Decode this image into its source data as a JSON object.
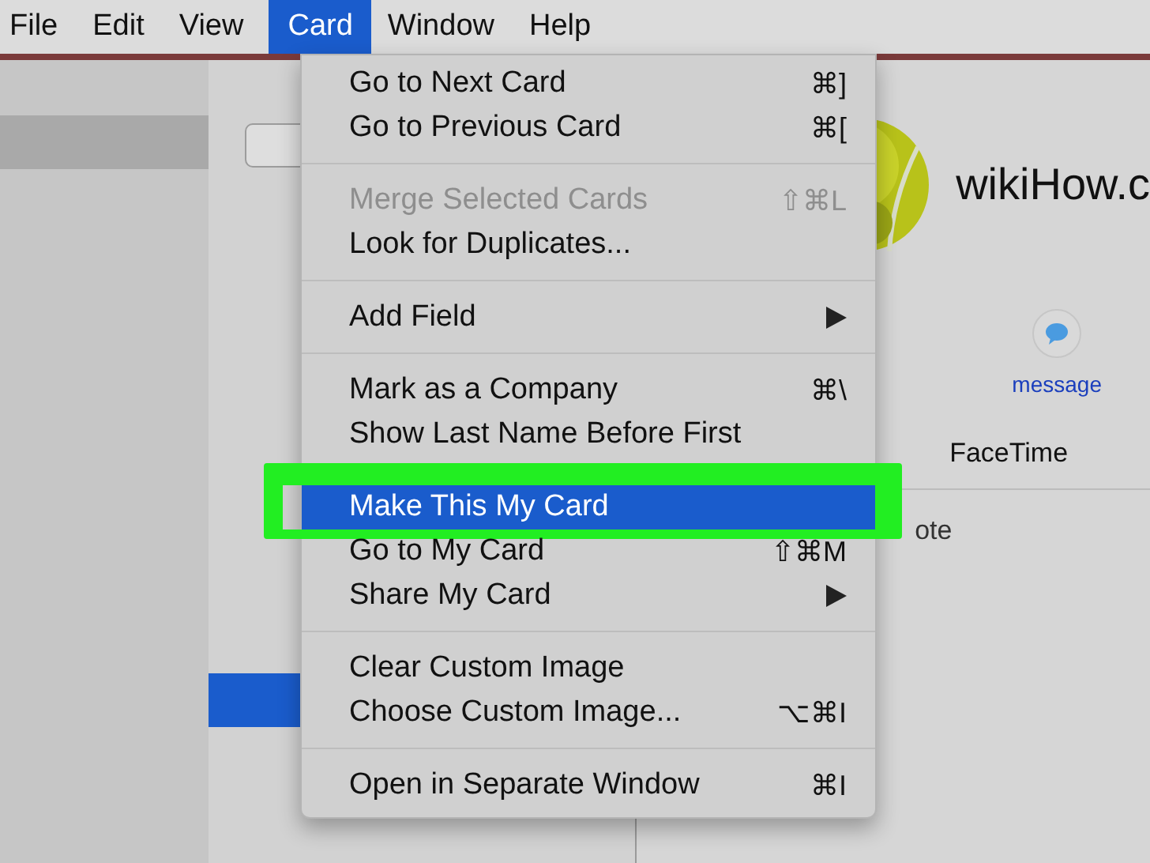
{
  "menu_bar": [
    {
      "label": "File",
      "selected": false
    },
    {
      "label": "Edit",
      "selected": false
    },
    {
      "label": "View",
      "selected": false
    },
    {
      "label": "Card",
      "selected": true
    },
    {
      "label": "Window",
      "selected": false
    },
    {
      "label": "Help",
      "selected": false
    }
  ],
  "menu": [
    {
      "kind": "item",
      "label": "Go to Next Card",
      "shortcut": "⌘]",
      "disabled": false,
      "selected": false
    },
    {
      "kind": "item",
      "label": "Go to Previous Card",
      "shortcut": "⌘[",
      "disabled": false,
      "selected": false
    },
    {
      "kind": "separator"
    },
    {
      "kind": "item",
      "label": "Merge Selected Cards",
      "shortcut": "⇧⌘L",
      "disabled": true,
      "selected": false
    },
    {
      "kind": "item",
      "label": "Look for Duplicates...",
      "disabled": false,
      "selected": false
    },
    {
      "kind": "separator"
    },
    {
      "kind": "submenu",
      "label": "Add Field",
      "disabled": false,
      "selected": false
    },
    {
      "kind": "separator"
    },
    {
      "kind": "item",
      "label": "Mark as a Company",
      "shortcut": "⌘\\",
      "disabled": false,
      "selected": false
    },
    {
      "kind": "item",
      "label": "Show Last Name Before First",
      "disabled": false,
      "selected": false
    },
    {
      "kind": "separator"
    },
    {
      "kind": "item",
      "label": "Make This My Card",
      "disabled": false,
      "selected": true,
      "outlined": true
    },
    {
      "kind": "item",
      "label": "Go to My Card",
      "shortcut": "⇧⌘M",
      "disabled": false,
      "selected": false
    },
    {
      "kind": "submenu",
      "label": "Share My Card",
      "disabled": false,
      "selected": false
    },
    {
      "kind": "separator"
    },
    {
      "kind": "item",
      "label": "Clear Custom Image",
      "disabled": false,
      "selected": false
    },
    {
      "kind": "item",
      "label": "Choose Custom Image...",
      "shortcut": "⌥⌘I",
      "disabled": false,
      "selected": false
    },
    {
      "kind": "separator"
    },
    {
      "kind": "item",
      "label": "Open in Separate Window",
      "shortcut": "⌘I",
      "disabled": false,
      "selected": false
    }
  ],
  "card": {
    "name": "wikiHow.c",
    "actions": [
      {
        "label": "message"
      }
    ],
    "facetime_label": "FaceTime",
    "field_label": "ote"
  }
}
